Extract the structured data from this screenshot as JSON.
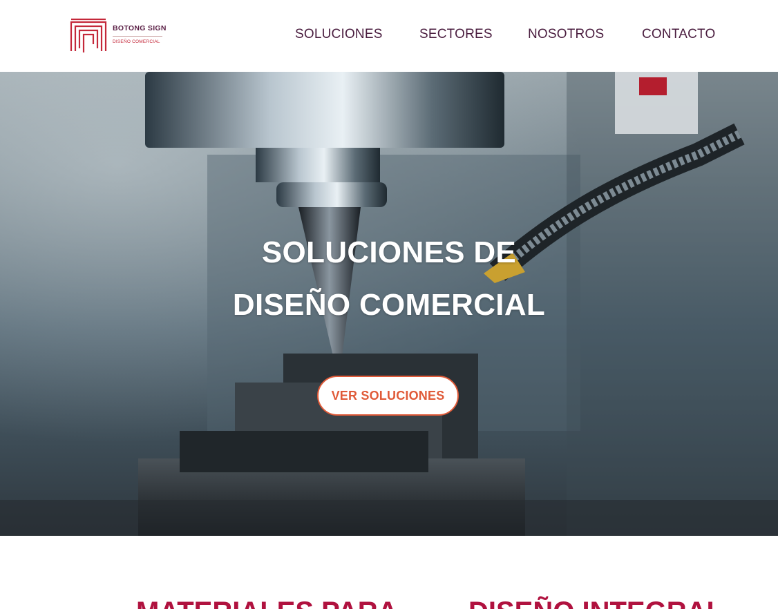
{
  "brand": {
    "name": "BOTONG SIGN",
    "tagline": "DISEÑO COMERCIAL",
    "colors": {
      "primary": "#b0123f",
      "nav_text": "#4a1d3f",
      "cta_accent": "#e05a38"
    }
  },
  "nav": {
    "items": [
      {
        "label": "SOLUCIONES"
      },
      {
        "label": "SECTORES"
      },
      {
        "label": "NOSOTROS"
      },
      {
        "label": "CONTACTO"
      }
    ]
  },
  "hero": {
    "title_line1": "SOLUCIONES DE",
    "title_line2": "DISEÑO COMERCIAL",
    "cta_label": "VER SOLUCIONES",
    "background": "cnc-milling-machine-photo"
  },
  "sections": {
    "teaser_left": "MATERIALES PARA",
    "teaser_right": "DISEÑO INTEGRAL"
  }
}
